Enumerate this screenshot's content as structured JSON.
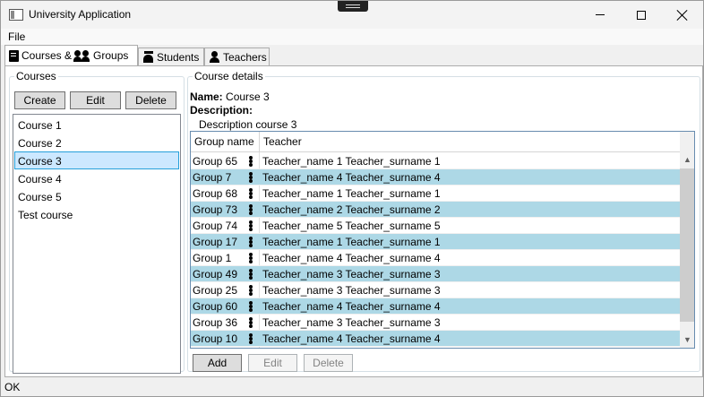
{
  "window": {
    "title": "University Application"
  },
  "menu": {
    "file": "File"
  },
  "tabs": [
    {
      "label": "Courses &",
      "label2": "Groups",
      "active": true
    },
    {
      "label": "Students",
      "active": false
    },
    {
      "label": "Teachers",
      "active": false
    }
  ],
  "courses_panel": {
    "legend": "Courses",
    "buttons": {
      "create": "Create",
      "edit": "Edit",
      "delete": "Delete"
    },
    "items": [
      {
        "label": "Course 1"
      },
      {
        "label": "Course 2"
      },
      {
        "label": "Course 3",
        "selected": true
      },
      {
        "label": "Course 4"
      },
      {
        "label": "Course 5"
      },
      {
        "label": "Test course"
      }
    ]
  },
  "details": {
    "legend": "Course details",
    "name_label": "Name:",
    "name_value": "Course 3",
    "description_label": "Description:",
    "description_value": "Description course 3",
    "grid": {
      "columns": [
        "Group name",
        "Teacher"
      ],
      "rows": [
        {
          "group": "Group 65",
          "teacher": "Teacher_name 1 Teacher_surname 1"
        },
        {
          "group": "Group 7",
          "teacher": "Teacher_name 4 Teacher_surname 4"
        },
        {
          "group": "Group 68",
          "teacher": "Teacher_name 1 Teacher_surname 1"
        },
        {
          "group": "Group 73",
          "teacher": "Teacher_name 2 Teacher_surname 2"
        },
        {
          "group": "Group 74",
          "teacher": "Teacher_name 5 Teacher_surname 5"
        },
        {
          "group": "Group 17",
          "teacher": "Teacher_name 1 Teacher_surname 1"
        },
        {
          "group": "Group 1",
          "teacher": "Teacher_name 4 Teacher_surname 4"
        },
        {
          "group": "Group 49",
          "teacher": "Teacher_name 3 Teacher_surname 3"
        },
        {
          "group": "Group 25",
          "teacher": "Teacher_name 3 Teacher_surname 3"
        },
        {
          "group": "Group 60",
          "teacher": "Teacher_name 4 Teacher_surname 4"
        },
        {
          "group": "Group 36",
          "teacher": "Teacher_name 3 Teacher_surname 3"
        },
        {
          "group": "Group 10",
          "teacher": "Teacher_name 4 Teacher_surname 4"
        }
      ],
      "alternate_row_color": "#add8e6"
    },
    "buttons": {
      "add": "Add",
      "edit": "Edit",
      "delete": "Delete"
    }
  },
  "status": {
    "text": "OK"
  },
  "colors": {
    "selection": "#cce8ff",
    "selection_border": "#26a0da",
    "grid_border": "#688caf"
  }
}
